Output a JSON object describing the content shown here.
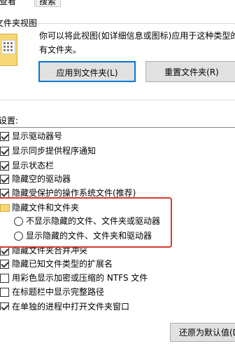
{
  "tabs": {
    "view": "查看",
    "search": "搜索"
  },
  "folder_views": {
    "group_title": "文件夹视图",
    "description_line1": "你可以将此视图(如详细信息或图标)应用于这种类型的",
    "description_line2": "有文件夹。",
    "apply_button": "应用到文件夹(L)",
    "reset_button": "重置文件夹(R)"
  },
  "advanced": {
    "title": "设置:",
    "items": [
      {
        "label": "显示驱动器号",
        "checked": true
      },
      {
        "label": "显示同步提供程序通知",
        "checked": true
      },
      {
        "label": "显示状态栏",
        "checked": true
      },
      {
        "label": "隐藏空的驱动器",
        "checked": true
      },
      {
        "label": "隐藏受保护的操作系统文件(推荐)",
        "checked": true
      }
    ],
    "hidden_group": {
      "label": "隐藏文件和文件夹",
      "options": [
        {
          "label": "不显示隐藏的文件、文件夹或驱动器",
          "selected": false
        },
        {
          "label": "显示隐藏的文件、文件夹和驱动器",
          "selected": false
        }
      ]
    },
    "items_after": [
      {
        "label": "隐藏文件夹合并冲突",
        "checked": true
      },
      {
        "label": "隐藏已知文件类型的扩展名",
        "checked": true
      },
      {
        "label": "用彩色显示加密或压缩的 NTFS 文件",
        "checked": false
      },
      {
        "label": "在标题栏中显示完整路径",
        "checked": false
      },
      {
        "label": "在单独的进程中打开文件夹窗口",
        "checked": true
      }
    ]
  },
  "restore_button": "还原为默认值(D)",
  "colors": {
    "highlight_border": "#d9382f",
    "focus_border": "#0078d7",
    "folder": "#f7d774"
  }
}
